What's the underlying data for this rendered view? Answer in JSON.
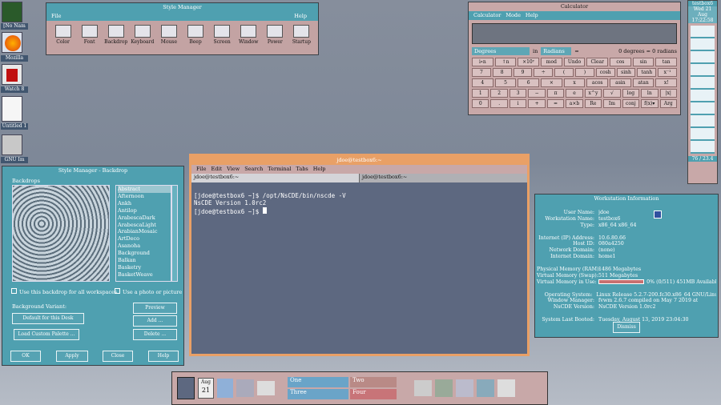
{
  "desktop_icons": [
    {
      "label": "[No Nam"
    },
    {
      "label": "Mozilla"
    },
    {
      "label": "Watch 8"
    },
    {
      "label": "Untitled 1"
    },
    {
      "label": "GNU Im"
    }
  ],
  "style_manager": {
    "title": "Style Manager",
    "menu": [
      "File",
      "Help"
    ],
    "items": [
      {
        "label": "Color",
        "icon": "palette-icon"
      },
      {
        "label": "Font",
        "icon": "font-icon"
      },
      {
        "label": "Backdrop",
        "icon": "backdrop-icon"
      },
      {
        "label": "Keyboard",
        "icon": "keyboard-icon"
      },
      {
        "label": "Mouse",
        "icon": "mouse-icon"
      },
      {
        "label": "Beep",
        "icon": "speaker-icon"
      },
      {
        "label": "Screen",
        "icon": "monitor-icon"
      },
      {
        "label": "Window",
        "icon": "window-icon"
      },
      {
        "label": "Power",
        "icon": "power-icon"
      },
      {
        "label": "Startup",
        "icon": "key-icon"
      }
    ]
  },
  "calculator": {
    "title": "Calculator",
    "menu": [
      "Calculator",
      "Mode",
      "Help"
    ],
    "degrees": "Degrees",
    "in": "in",
    "radians": "Radians",
    "eq": "=",
    "result": "0 degrees = 0 radians",
    "rows": [
      [
        "i∘n",
        "↑n",
        "×10ʸ",
        "mod",
        "Undo",
        "Clear",
        "cos",
        "sin",
        "tan"
      ],
      [
        "7",
        "8",
        "9",
        "÷",
        "(",
        ")",
        "cosh",
        "sinh",
        "tanh",
        "x⁻¹"
      ],
      [
        "4",
        "5",
        "6",
        "×",
        "x",
        "acos",
        "asin",
        "atan",
        "x!"
      ],
      [
        "1",
        "2",
        "3",
        "−",
        "π",
        "e",
        "x^y",
        "√",
        "log",
        "ln",
        "|x|"
      ],
      [
        "0",
        ".",
        "i",
        "+",
        "=",
        "a×b",
        "Re",
        "Im",
        "conj",
        "f(x)▾",
        "Arg"
      ]
    ]
  },
  "backdrop": {
    "title": "Style Manager - Backdrop",
    "section": "Backdrops",
    "list": [
      "Abstract",
      "Afternoon",
      "Ankh",
      "Antilop",
      "ArabescaDark",
      "ArabescaLight",
      "ArabianMosaic",
      "ArtDeco",
      "Asanoha",
      "Background",
      "Balkan",
      "Basketry",
      "BasketWeave"
    ],
    "check_all": "Use this backdrop for all workspaces",
    "check_photo": "Use a photo or picture",
    "variant_label": "Background Variant:",
    "variant": "Default for this Desk",
    "preview": "Preview",
    "add": "Add ...",
    "delete": "Delete ...",
    "load_palette": "Load Custom Palette ...",
    "ok": "OK",
    "apply": "Apply",
    "close": "Close",
    "help": "Help"
  },
  "terminal": {
    "title": "jdoe@testbox6:~",
    "menu": [
      "File",
      "Edit",
      "View",
      "Search",
      "Terminal",
      "Tabs",
      "Help"
    ],
    "tabs": [
      "jdoe@testbox6:~",
      "jdoe@testbox6:~"
    ],
    "lines": [
      "[jdoe@testbox6 ~]$ /opt/NsCDE/bin/nscde -V",
      "NsCDE Version 1.0rc2",
      "[jdoe@testbox6 ~]$ "
    ]
  },
  "workstation": {
    "title": "Workstation Information",
    "fields": [
      [
        "User Name:",
        "jdoe"
      ],
      [
        "Workstation Name:",
        "testbox6"
      ],
      [
        "Type:",
        "x86_64 x86_64"
      ],
      [
        "",
        ""
      ],
      [
        "Internet (IP) Address:",
        "10.6.80.66"
      ],
      [
        "Host ID:",
        "080a4250"
      ],
      [
        "Network Domain:",
        "(none)"
      ],
      [
        "Internet Domain:",
        "home1"
      ],
      [
        "",
        ""
      ],
      [
        "Physical Memory (RAM):",
        "1486 Megabytes"
      ],
      [
        "Virtual Memory (Swap):",
        "511 Megabytes"
      ],
      [
        "Virtual Memory in Use:",
        "0% (0/511) 451MB Available"
      ],
      [
        "",
        ""
      ],
      [
        "Operating System:",
        "Linux Release 5.2.7-200.fc30.x86_64 GNU/Linux"
      ],
      [
        "Window Manager:",
        "fvwm 2.6.7 compiled on May  7 2019 at"
      ],
      [
        "NsCDE Version:",
        "NsCDE Version 1.0rc2"
      ],
      [
        "",
        ""
      ],
      [
        "System Last Booted:",
        "Tuesday, August 13, 2019 23:04:30"
      ]
    ],
    "dismiss": "Dismiss"
  },
  "right_panel": {
    "host": "testbox6",
    "date": "Wed 21 Aug",
    "time": "17:22:58",
    "extra": "76 / 23.4"
  },
  "front_panel": {
    "date_month": "Aug",
    "date_day": "21",
    "workspaces": [
      "One",
      "Two",
      "Three",
      "Four"
    ]
  },
  "colors": {
    "teal": "#4fa0b0",
    "calc": "#c8a8a8",
    "sm": "#c3a3a3",
    "term": "#5d6880"
  }
}
